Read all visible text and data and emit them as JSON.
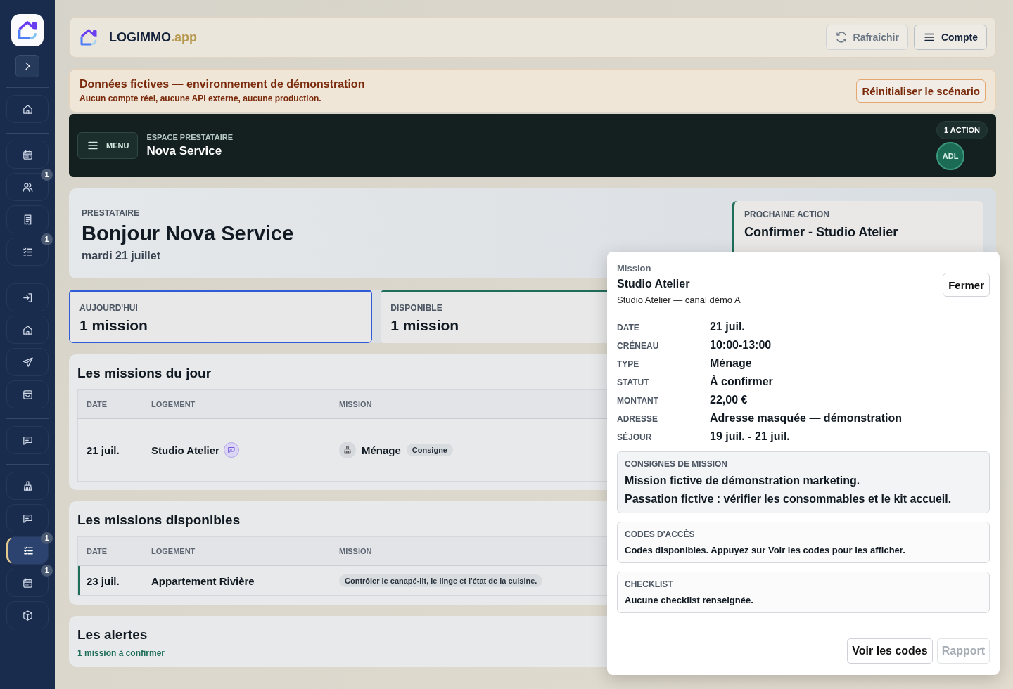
{
  "sidebar": {
    "items": [
      {
        "selected": false
      },
      {
        "selected": false
      },
      {
        "selected": false,
        "badge": "1"
      },
      {
        "selected": false
      },
      {
        "selected": false,
        "badge": "1"
      },
      {
        "selected": false
      },
      {
        "selected": false
      },
      {
        "selected": false
      },
      {
        "selected": false
      },
      {
        "selected": false
      },
      {
        "selected": false
      },
      {
        "selected": false
      },
      {
        "selected": true,
        "badge": "1"
      },
      {
        "selected": false,
        "badge": "1"
      },
      {
        "selected": false
      }
    ]
  },
  "topbar": {
    "brand": "LOGIMMO",
    "brand_suffix": ".app",
    "buttons": [
      {
        "label": "Rafraîchir",
        "disabled": true
      },
      {
        "label": "Compte",
        "disabled": false
      }
    ]
  },
  "demo_banner": {
    "title": "Données fictives — environnement de démonstration",
    "text": "Aucun compte réel, aucune API externe, aucune production.",
    "button": "Réinitialiser le scénario"
  },
  "header": {
    "menu_button": "MENU",
    "eyebrow": "ESPACE PRESTATAIRE",
    "title": "Nova Service",
    "badge": "1 ACTION",
    "avatar": "ADL"
  },
  "hero": {
    "eyebrow": "PRESTATAIRE",
    "title": "Bonjour Nova Service",
    "date": "mardi 21 juillet",
    "next_action": {
      "label": "PROCHAINE ACTION",
      "title": "Confirmer - Studio Atelier"
    }
  },
  "stats": [
    {
      "label": "AUJOURD'HUI",
      "value": "1 mission",
      "selected": true,
      "color": "#2f5bd6"
    },
    {
      "label": "DISPONIBLE",
      "value": "1 mission",
      "selected": false,
      "color": "#1f6e5a"
    }
  ],
  "sections": [
    {
      "title": "Les missions du jour",
      "columns": [
        "DATE",
        "LOGEMENT",
        "MISSION"
      ],
      "rows": [
        {
          "date": "21 juil.",
          "logement": "Studio Atelier",
          "has_note": true,
          "mission_type": "Ménage",
          "tag": "Consigne",
          "highlighted": false
        }
      ]
    },
    {
      "title": "Les missions disponibles",
      "columns": [
        "DATE",
        "LOGEMENT",
        "MISSION"
      ],
      "rows": [
        {
          "date": "23 juil.",
          "logement": "Appartement Rivière",
          "has_note": false,
          "tag": "Contrôler le canapé-lit, le linge et l'état de la cuisine.",
          "highlighted": true
        }
      ]
    },
    {
      "title": "Les alertes",
      "subtitle": "1 mission à confirmer"
    }
  ],
  "popup": {
    "eyebrow": "Mission",
    "title": "Studio Atelier",
    "subtitle": "Studio Atelier — canal démo A",
    "close_button": "Fermer",
    "details": [
      {
        "label": "DATE",
        "value": "21 juil."
      },
      {
        "label": "CRÉNEAU",
        "value": "10:00-13:00"
      },
      {
        "label": "TYPE",
        "value": "Ménage"
      },
      {
        "label": "STATUT",
        "value": "À confirmer"
      },
      {
        "label": "MONTANT",
        "value": "22,00 €"
      },
      {
        "label": "ADRESSE",
        "value": "Adresse masquée — démonstration"
      },
      {
        "label": "SÉJOUR",
        "value": "19 juil. - 21 juil."
      }
    ],
    "boxes": [
      {
        "title": "CONSIGNES DE MISSION",
        "lines": [
          "Mission fictive de démonstration marketing.",
          "Passation fictive : vérifier les consommables et le kit accueil."
        ],
        "emphasis": true
      },
      {
        "title": "CODES D'ACCÈS",
        "lines": [
          "Codes disponibles. Appuyez sur Voir les codes pour les afficher."
        ],
        "emphasis": false
      },
      {
        "title": "CHECKLIST",
        "lines": [
          "Aucune checklist renseignée."
        ],
        "emphasis": false
      }
    ],
    "buttons": [
      {
        "label": "Voir les codes",
        "disabled": false
      },
      {
        "label": "Rapport",
        "disabled": true
      }
    ]
  }
}
